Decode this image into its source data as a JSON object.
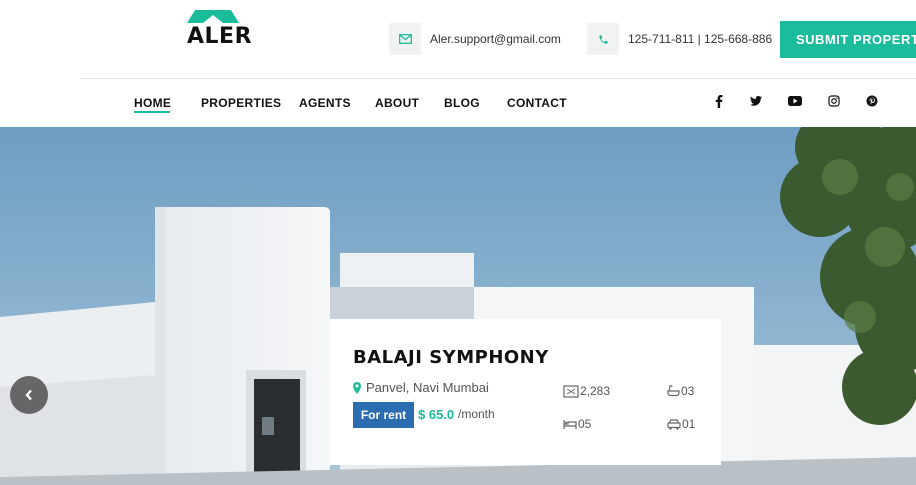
{
  "brand": {
    "name": "ALER",
    "accent": "#1abc9c"
  },
  "contact": {
    "email": "Aler.support@gmail.com",
    "phone": "125-711-811 | 125-668-886"
  },
  "submit_label": "SUBMIT PROPERTY",
  "nav": {
    "items": [
      "HOME",
      "PROPERTIES",
      "AGENTS",
      "ABOUT",
      "BLOG",
      "CONTACT"
    ],
    "active": "HOME"
  },
  "social": [
    "facebook-icon",
    "twitter-icon",
    "youtube-icon",
    "instagram-icon",
    "pinterest-icon"
  ],
  "listing": {
    "title": "BALAJI SYMPHONY",
    "location": "Panvel, Navi Mumbai",
    "badge": "For rent",
    "price": "$ 65.0",
    "period": "/month",
    "area": "2,283",
    "bathrooms": "03",
    "bedrooms": "05",
    "garage": "01"
  }
}
